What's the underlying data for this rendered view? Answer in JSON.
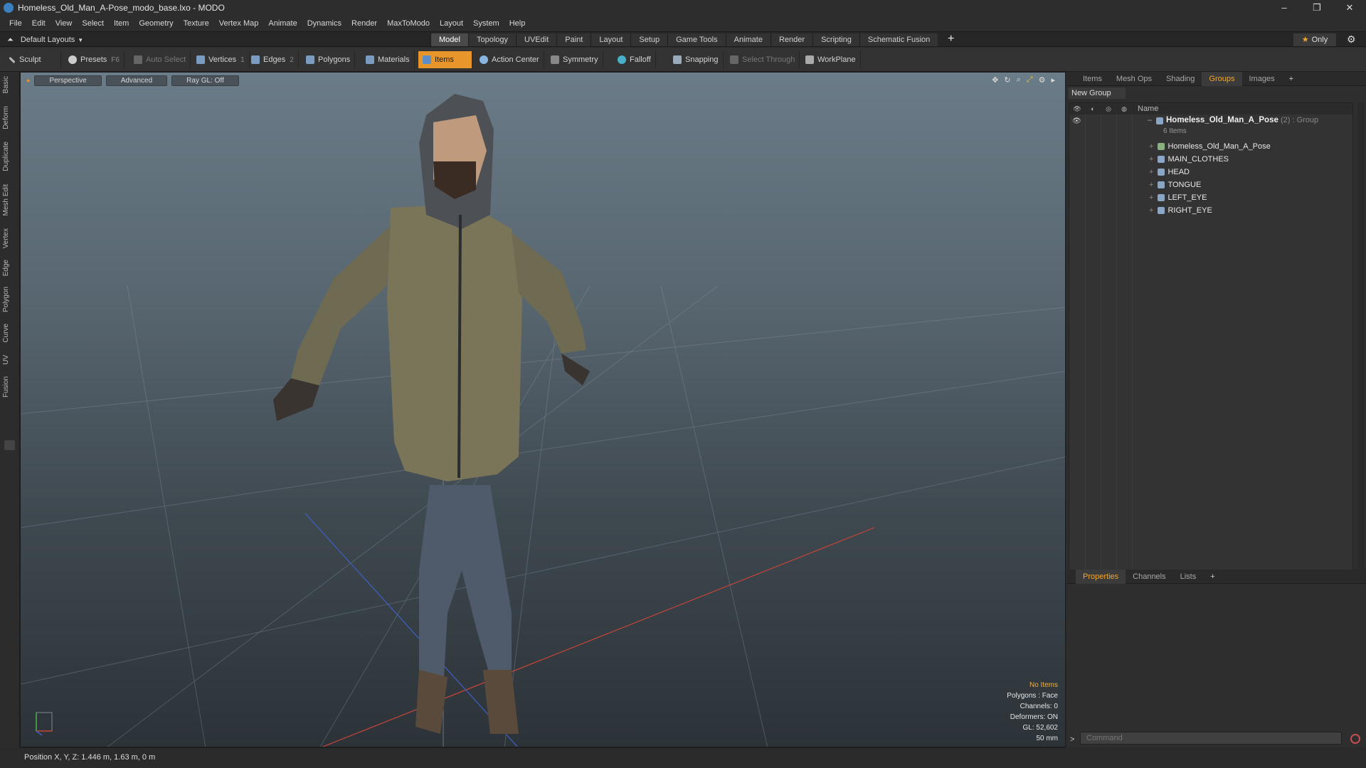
{
  "window": {
    "title": "Homeless_Old_Man_A-Pose_modo_base.lxo - MODO",
    "minimize": "–",
    "restore": "❐",
    "close": "✕"
  },
  "menu": [
    "File",
    "Edit",
    "View",
    "Select",
    "Item",
    "Geometry",
    "Texture",
    "Vertex Map",
    "Animate",
    "Dynamics",
    "Render",
    "MaxToModo",
    "Layout",
    "System",
    "Help"
  ],
  "layoutbar": {
    "layout_label": "Default Layouts",
    "tabs": [
      "Model",
      "Topology",
      "UVEdit",
      "Paint",
      "Layout",
      "Setup",
      "Game Tools",
      "Animate",
      "Render",
      "Scripting",
      "Schematic Fusion"
    ],
    "active_tab": "Model",
    "plus": "+",
    "only_label": "Only",
    "star": "★",
    "gear": "⚙"
  },
  "toolbar": {
    "sculpt": "Sculpt",
    "presets": "Presets",
    "presets_key": "F6",
    "auto_select": "Auto Select",
    "vertices": "Vertices",
    "vertices_key": "1",
    "edges": "Edges",
    "edges_key": "2",
    "polygons": "Polygons",
    "materials": "Materials",
    "items": "Items",
    "action_center": "Action Center",
    "symmetry": "Symmetry",
    "falloff": "Falloff",
    "snapping": "Snapping",
    "select_through": "Select Through",
    "workplane": "WorkPlane"
  },
  "lefttabs": [
    "Basic",
    "Deform",
    "Duplicate",
    "Mesh Edit",
    "Vertex",
    "Edge",
    "Polygon",
    "Curve",
    "UV",
    "Fusion"
  ],
  "viewport": {
    "view_mode": "Perspective",
    "shading": "Advanced",
    "raygl": "Ray GL: Off",
    "info": {
      "selection": "No Items",
      "polygons": "Polygons : Face",
      "channels": "Channels: 0",
      "deformers": "Deformers: ON",
      "gl": "GL: 52,602",
      "focal": "50 mm"
    }
  },
  "rightpanel": {
    "top_tabs": [
      "Items",
      "Mesh Ops",
      "Shading",
      "Groups",
      "Images"
    ],
    "active_top_tab": "Groups",
    "new_group": "New Group",
    "name_header": "Name",
    "group": {
      "name": "Homeless_Old_Man_A_Pose",
      "count": "(2)",
      "type": ": Group",
      "sub": "6 Items"
    },
    "items": [
      "Homeless_Old_Man_A_Pose",
      "MAIN_CLOTHES",
      "HEAD",
      "TONGUE",
      "LEFT_EYE",
      "RIGHT_EYE"
    ],
    "bottom_tabs": [
      "Properties",
      "Channels",
      "Lists"
    ],
    "active_bottom_tab": "Properties",
    "command_placeholder": "Command",
    "prompt": ">"
  },
  "status": {
    "position": "Position X, Y, Z:   1.446 m, 1.63 m, 0 m"
  },
  "colors": {
    "accent": "#f0a830",
    "active_tool": "#e8962a",
    "viewport_top": "#6a7c88"
  }
}
